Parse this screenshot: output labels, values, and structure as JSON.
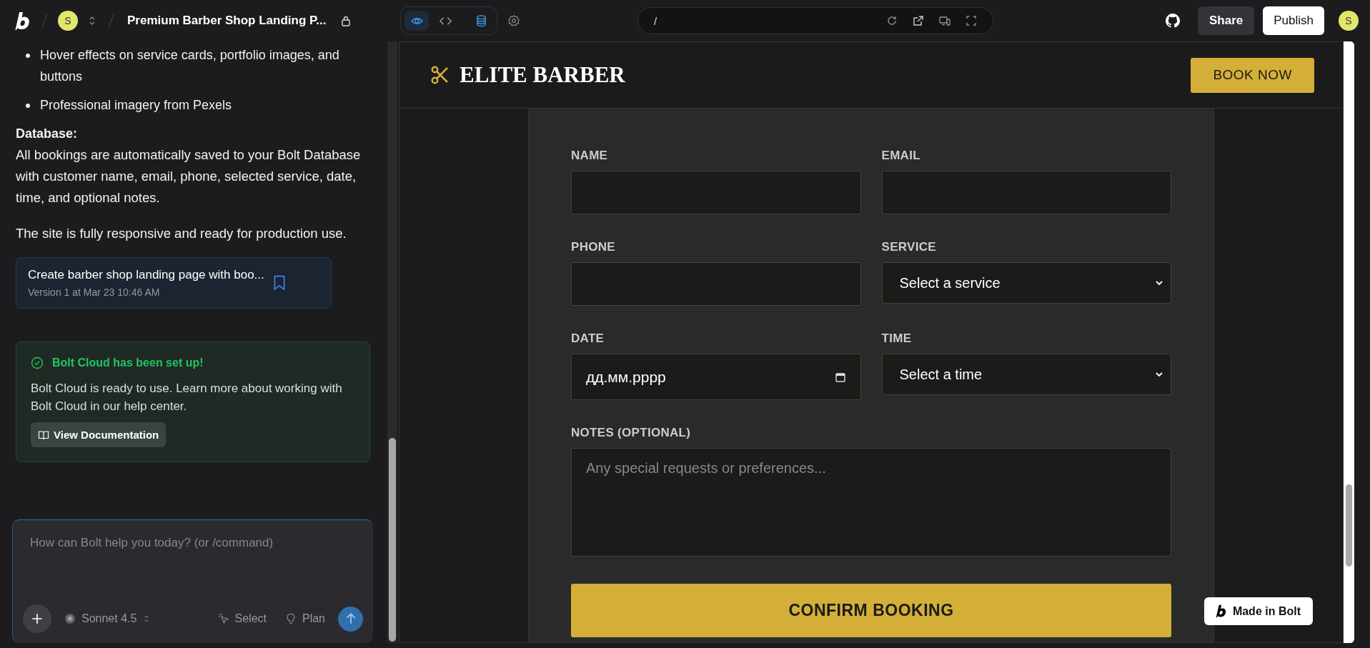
{
  "topbar": {
    "project_avatar": "S",
    "project_title": "Premium Barber Shop Landing P...",
    "view_tabs": [
      {
        "kind": "preview",
        "selected": true
      },
      {
        "kind": "code",
        "selected": false
      },
      {
        "kind": "database",
        "selected": false
      }
    ],
    "url": "/",
    "share": "Share",
    "publish": "Publish",
    "user_avatar": "S"
  },
  "chat": {
    "bullets": [
      "Hover effects on service cards, portfolio images, and buttons",
      "Professional imagery from Pexels"
    ],
    "database_heading": "Database:",
    "database_text": "All bookings are automatically saved to your Bolt Database with customer name, email, phone, selected service, date, time, and optional notes.",
    "closing_text": "The site is fully responsive and ready for production use.",
    "version_card": {
      "title": "Create barber shop landing page with boo...",
      "subtitle": "Version 1 at Mar 23 10:46 AM"
    },
    "cloud_notice": {
      "title": "Bolt Cloud has been set up!",
      "text": "Bolt Cloud is ready to use. Learn more about working with Bolt Cloud in our help center.",
      "button": "View Documentation"
    },
    "prompt": {
      "placeholder": "How can Bolt help you today? (or /command)",
      "model": "Sonnet 4.5",
      "select": "Select",
      "plan": "Plan"
    }
  },
  "preview": {
    "brand": "ELITE BARBER",
    "book_button": "BOOK NOW",
    "fields": [
      {
        "kind": "text",
        "label": "NAME"
      },
      {
        "kind": "text",
        "label": "EMAIL"
      },
      {
        "kind": "text",
        "label": "PHONE"
      },
      {
        "kind": "select",
        "label": "SERVICE",
        "value": "Select a service"
      },
      {
        "kind": "date",
        "label": "DATE",
        "value": "дд.мм.рррр"
      },
      {
        "kind": "select",
        "label": "TIME",
        "value": "Select a time"
      },
      {
        "kind": "textarea",
        "label": "NOTES (OPTIONAL)",
        "placeholder": "Any special requests or preferences..."
      }
    ],
    "confirm_button": "CONFIRM BOOKING",
    "badge": "Made in Bolt"
  }
}
